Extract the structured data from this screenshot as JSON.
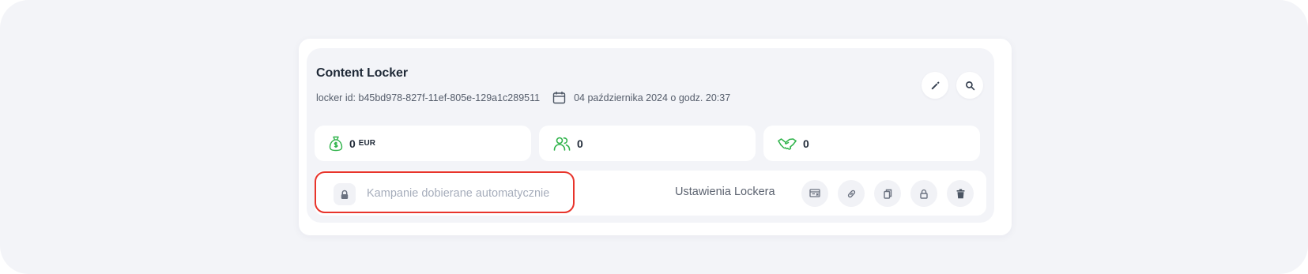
{
  "locker": {
    "title": "Content Locker",
    "id_label": "locker id: b45bd978-827f-11ef-805e-129a1c289511",
    "date_label": "04 października 2024 o godz. 20:37"
  },
  "header_actions": [
    "edit-icon",
    "search-icon"
  ],
  "stats": {
    "revenue": {
      "value": "0",
      "unit": "EUR",
      "icon": "money-bag-icon"
    },
    "users": {
      "value": "0",
      "icon": "users-icon"
    },
    "deals": {
      "value": "0",
      "icon": "handshake-icon"
    }
  },
  "campaigns": {
    "label": "Kampanie dobierane automatycznie",
    "icon": "lock-icon",
    "highlight_color": "#e8342b"
  },
  "settings": {
    "label": "Ustawienia Lockera",
    "actions": [
      "preview-icon",
      "link-icon",
      "copy-icon",
      "lock-icon",
      "trash-icon"
    ]
  },
  "colors": {
    "accent_green": "#2fb34a",
    "page_bg": "#f3f4f8",
    "highlight": "#e8342b"
  }
}
